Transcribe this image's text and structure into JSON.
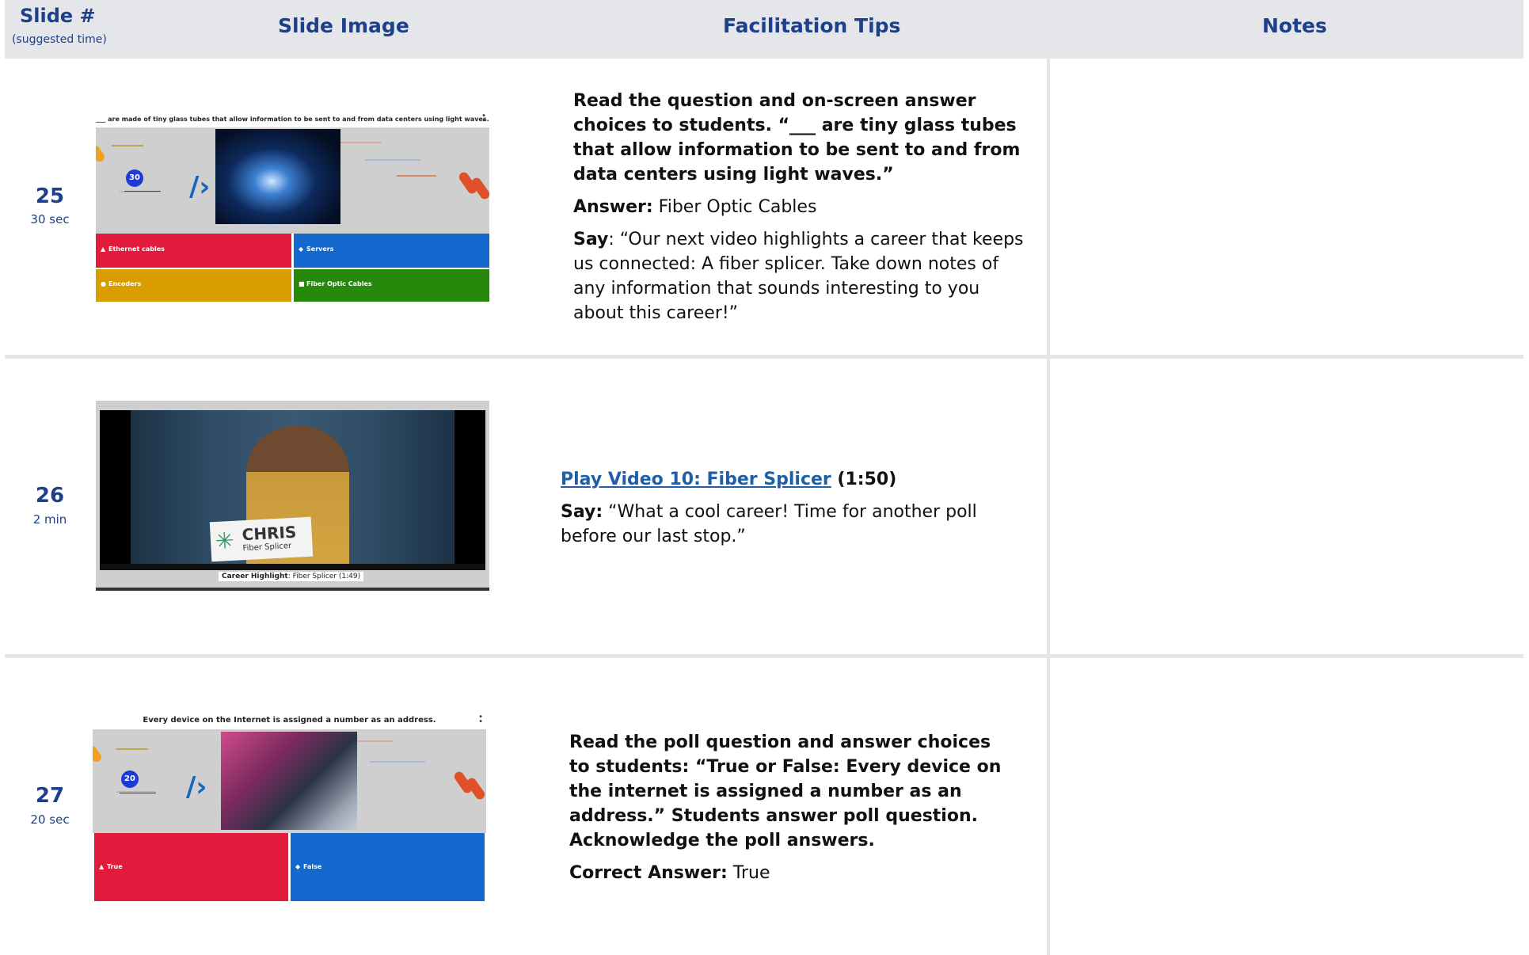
{
  "header": {
    "slide_label": "Slide #",
    "slide_sub": "(suggested time)",
    "image_label": "Slide Image",
    "tips_label": "Facilitation Tips",
    "notes_label": "Notes"
  },
  "rows": [
    {
      "number": "25",
      "time": "30 sec",
      "thumb": {
        "question": "___ are made of tiny glass tubes that allow information to be sent to and from data centers using light waves.",
        "timer": "30",
        "answers": [
          "Ethernet cables",
          "Servers",
          "Encoders",
          "Fiber Optic Cables"
        ]
      },
      "tips": {
        "p1": "Read the question and on-screen answer choices to students. “___ are tiny glass tubes that allow information to be sent to and from data centers using light waves.”",
        "answer_label": "Answer:",
        "answer_text": " Fiber Optic Cables",
        "say_label": "Say",
        "say_text": ": “Our next video highlights a career that keeps us connected: A fiber splicer. Take down notes of any information that sounds interesting to you about this career!”"
      }
    },
    {
      "number": "26",
      "time": "2 min",
      "thumb": {
        "name": "CHRIS",
        "role": "Fiber Splicer",
        "caption_bold": "Career Highlight",
        "caption_rest": ": Fiber Splicer (1:49)"
      },
      "tips": {
        "link_text": "Play Video 10: Fiber Splicer",
        "duration": " (1:50)",
        "say_label": "Say:",
        "say_text": " “What a cool career! Time for another poll before our last stop.”"
      }
    },
    {
      "number": "27",
      "time": "20 sec",
      "thumb": {
        "question": "Every device on the Internet is assigned a number as an address.",
        "timer": "20",
        "answers": [
          "True",
          "False"
        ]
      },
      "tips": {
        "p1": "Read the poll question and answer choices to students: “True or False: Every device on the internet is assigned a number as an address.” Students answer poll question. Acknowledge the poll answers.",
        "answer_label": "Correct Answer:",
        "answer_text": " True"
      }
    }
  ],
  "colors": {
    "header_bg": "#e4e6e9",
    "header_text": "#1e3f8a",
    "link": "#1f5fa8",
    "answer_red": "#e21b3c",
    "answer_blue": "#1368ce",
    "answer_yellow": "#d89e00",
    "answer_green": "#26890c"
  }
}
